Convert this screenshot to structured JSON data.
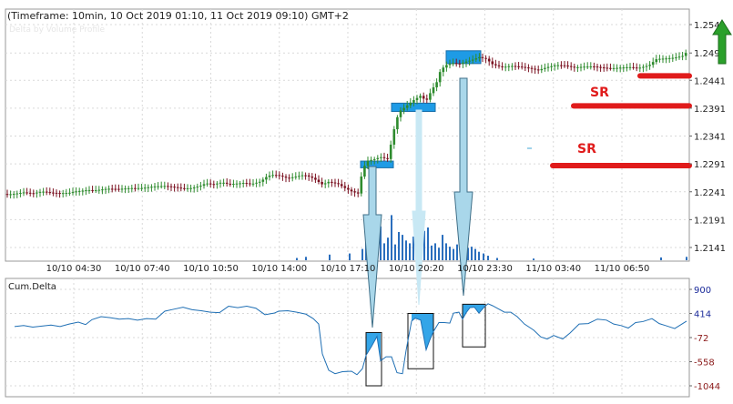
{
  "header": {
    "title": "(Timeframe: 10min, 10 Oct 2019 01:10, 11 Oct 2019 09:10) GMT+2",
    "faint_subtitle": "Delta by Volume Profile"
  },
  "annotations": {
    "sr_upper": "SR",
    "sr_lower": "SR",
    "arrow_icon": "up-arrow-icon"
  },
  "colors": {
    "background": "#ffffff",
    "grid": "#d9d9d9",
    "bull_candle": "#2e8b2e",
    "bear_candle": "#7a1020",
    "volume": "#2a6ebd",
    "cum_delta_line": "#1f6fb4",
    "highlight_box": "#1e9be6",
    "sr_line": "#e01b1b",
    "arrow_fill": "#a9d7ea",
    "green_arrow": "#2ba02b"
  },
  "chart_data": [
    {
      "type": "candlestick",
      "title": "(Timeframe: 10min, 10 Oct 2019 01:10, 11 Oct 2019 09:10) GMT+2",
      "x_tick_labels": [
        "10/10 04:30",
        "10/10 07:40",
        "10/10 10:50",
        "10/10 14:00",
        "10/10 17:10",
        "10/10 20:20",
        "10/10 23:30",
        "11/10 03:40",
        "11/10 06:50"
      ],
      "y_tick_labels": [
        "1.2541",
        "1.2490",
        "1.2441",
        "1.2391",
        "1.2341",
        "1.2291",
        "1.2241",
        "1.2191",
        "1.2141"
      ],
      "ylim": [
        1.2141,
        1.2541
      ],
      "close_path": [
        [
          0,
          1.2237
        ],
        [
          10,
          1.2237
        ],
        [
          20,
          1.2238
        ],
        [
          30,
          1.2235
        ],
        [
          40,
          1.2238
        ],
        [
          50,
          1.2236
        ],
        [
          60,
          1.2236
        ],
        [
          70,
          1.2238
        ],
        [
          78,
          1.2242
        ],
        [
          90,
          1.2246
        ],
        [
          100,
          1.2247
        ],
        [
          112,
          1.225
        ],
        [
          125,
          1.2249
        ],
        [
          137,
          1.2249
        ],
        [
          150,
          1.2247
        ],
        [
          162,
          1.2248
        ],
        [
          175,
          1.2248
        ],
        [
          185,
          1.2246
        ],
        [
          195,
          1.2244
        ],
        [
          205,
          1.2246
        ],
        [
          215,
          1.2252
        ],
        [
          220,
          1.2257
        ],
        [
          228,
          1.2256
        ],
        [
          238,
          1.2261
        ],
        [
          245,
          1.2258
        ],
        [
          252,
          1.2259
        ],
        [
          262,
          1.226
        ],
        [
          270,
          1.2257
        ],
        [
          280,
          1.226
        ],
        [
          288,
          1.2269
        ],
        [
          295,
          1.227
        ],
        [
          302,
          1.2267
        ],
        [
          310,
          1.2262
        ],
        [
          320,
          1.2265
        ],
        [
          328,
          1.2268
        ],
        [
          338,
          1.2263
        ],
        [
          348,
          1.2253
        ],
        [
          355,
          1.2259
        ],
        [
          365,
          1.2257
        ],
        [
          372,
          1.2251
        ],
        [
          380,
          1.2245
        ],
        [
          388,
          1.2241
        ],
        [
          392,
          1.2285
        ],
        [
          398,
          1.23
        ],
        [
          405,
          1.2302
        ],
        [
          412,
          1.2305
        ],
        [
          420,
          1.23
        ],
        [
          426,
          1.2348
        ],
        [
          432,
          1.2383
        ],
        [
          440,
          1.2392
        ],
        [
          448,
          1.2402
        ],
        [
          456,
          1.241
        ],
        [
          462,
          1.24
        ],
        [
          468,
          1.242
        ],
        [
          474,
          1.2436
        ],
        [
          478,
          1.2458
        ],
        [
          485,
          1.2468
        ],
        [
          492,
          1.2472
        ],
        [
          498,
          1.2471
        ],
        [
          505,
          1.2476
        ],
        [
          512,
          1.248
        ],
        [
          520,
          1.2486
        ],
        [
          528,
          1.2483
        ],
        [
          535,
          1.2473
        ],
        [
          545,
          1.2467
        ],
        [
          555,
          1.2468
        ],
        [
          565,
          1.2465
        ],
        [
          575,
          1.2461
        ],
        [
          585,
          1.2456
        ],
        [
          595,
          1.2461
        ],
        [
          605,
          1.2465
        ],
        [
          615,
          1.2465
        ],
        [
          625,
          1.2463
        ],
        [
          635,
          1.2466
        ],
        [
          645,
          1.2468
        ],
        [
          655,
          1.2467
        ],
        [
          665,
          1.2466
        ],
        [
          675,
          1.2467
        ],
        [
          685,
          1.2467
        ],
        [
          695,
          1.2464
        ],
        [
          700,
          1.2465
        ],
        [
          707,
          1.2467
        ],
        [
          715,
          1.2477
        ],
        [
          725,
          1.2477
        ],
        [
          735,
          1.2478
        ],
        [
          745,
          1.2482
        ],
        [
          748,
          1.2489
        ]
      ],
      "horizontal_levels": [
        {
          "label": "SR",
          "value": 1.2395
        },
        {
          "label": "SR",
          "value": 1.2288
        },
        {
          "label": "",
          "value": 1.2449
        }
      ],
      "highlight_zones": [
        {
          "t_start": 390,
          "t_end": 426,
          "low": 1.2284,
          "high": 1.2296
        },
        {
          "t_start": 424,
          "t_end": 472,
          "low": 1.2385,
          "high": 1.24
        },
        {
          "t_start": 484,
          "t_end": 522,
          "low": 1.2471,
          "high": 1.2494
        }
      ]
    },
    {
      "type": "bar",
      "name": "Volume",
      "values": [
        [
          392,
          0.2
        ],
        [
          396,
          0.7
        ],
        [
          400,
          0.35
        ],
        [
          404,
          0.55
        ],
        [
          408,
          0.25
        ],
        [
          412,
          0.6
        ],
        [
          416,
          0.3
        ],
        [
          420,
          0.4
        ],
        [
          424,
          0.8
        ],
        [
          428,
          0.28
        ],
        [
          432,
          0.5
        ],
        [
          436,
          0.45
        ],
        [
          440,
          0.35
        ],
        [
          444,
          0.3
        ],
        [
          448,
          0.42
        ],
        [
          452,
          0.38
        ],
        [
          456,
          0.33
        ],
        [
          460,
          0.52
        ],
        [
          464,
          0.58
        ],
        [
          468,
          0.26
        ],
        [
          472,
          0.3
        ],
        [
          476,
          0.22
        ],
        [
          480,
          0.45
        ],
        [
          484,
          0.3
        ],
        [
          488,
          0.24
        ],
        [
          492,
          0.2
        ],
        [
          496,
          0.28
        ],
        [
          500,
          0.26
        ],
        [
          504,
          0.34
        ],
        [
          508,
          0.22
        ],
        [
          512,
          0.24
        ],
        [
          516,
          0.2
        ],
        [
          520,
          0.15
        ],
        [
          525,
          0.12
        ],
        [
          530,
          0.08
        ],
        [
          320,
          0.04
        ],
        [
          330,
          0.06
        ],
        [
          356,
          0.1
        ],
        [
          378,
          0.12
        ],
        [
          540,
          0.04
        ],
        [
          580,
          0.03
        ],
        [
          720,
          0.05
        ],
        [
          748,
          0.06
        ]
      ]
    },
    {
      "type": "line",
      "name": "Cum.Delta",
      "y_tick_labels": [
        "900",
        "414",
        "-72",
        "-558",
        "-1044"
      ],
      "ylim": [
        -1044,
        900
      ],
      "points": [
        [
          10,
          150
        ],
        [
          20,
          170
        ],
        [
          30,
          140
        ],
        [
          40,
          160
        ],
        [
          50,
          180
        ],
        [
          60,
          150
        ],
        [
          70,
          200
        ],
        [
          80,
          240
        ],
        [
          88,
          190
        ],
        [
          95,
          290
        ],
        [
          105,
          350
        ],
        [
          115,
          330
        ],
        [
          125,
          300
        ],
        [
          135,
          310
        ],
        [
          145,
          280
        ],
        [
          155,
          310
        ],
        [
          165,
          300
        ],
        [
          175,
          460
        ],
        [
          185,
          500
        ],
        [
          195,
          540
        ],
        [
          205,
          490
        ],
        [
          215,
          470
        ],
        [
          225,
          440
        ],
        [
          235,
          430
        ],
        [
          245,
          560
        ],
        [
          255,
          530
        ],
        [
          265,
          560
        ],
        [
          275,
          520
        ],
        [
          285,
          390
        ],
        [
          295,
          420
        ],
        [
          300,
          460
        ],
        [
          310,
          470
        ],
        [
          320,
          440
        ],
        [
          330,
          400
        ],
        [
          338,
          310
        ],
        [
          344,
          200
        ],
        [
          348,
          -400
        ],
        [
          355,
          -730
        ],
        [
          362,
          -800
        ],
        [
          370,
          -760
        ],
        [
          380,
          -750
        ],
        [
          386,
          -820
        ],
        [
          392,
          -700
        ],
        [
          396,
          -430
        ],
        [
          402,
          -250
        ],
        [
          408,
          -50
        ],
        [
          412,
          -540
        ],
        [
          418,
          -460
        ],
        [
          424,
          -460
        ],
        [
          430,
          -780
        ],
        [
          436,
          -800
        ],
        [
          440,
          -330
        ],
        [
          446,
          260
        ],
        [
          450,
          320
        ],
        [
          456,
          280
        ],
        [
          462,
          -320
        ],
        [
          466,
          -120
        ],
        [
          470,
          50
        ],
        [
          476,
          230
        ],
        [
          482,
          230
        ],
        [
          488,
          220
        ],
        [
          492,
          420
        ],
        [
          498,
          440
        ],
        [
          502,
          300
        ],
        [
          506,
          430
        ],
        [
          510,
          530
        ],
        [
          515,
          540
        ],
        [
          520,
          420
        ],
        [
          526,
          550
        ],
        [
          530,
          610
        ],
        [
          535,
          570
        ],
        [
          540,
          520
        ],
        [
          548,
          440
        ],
        [
          555,
          440
        ],
        [
          562,
          350
        ],
        [
          570,
          200
        ],
        [
          580,
          80
        ],
        [
          588,
          -60
        ],
        [
          595,
          -100
        ],
        [
          602,
          -30
        ],
        [
          612,
          -100
        ],
        [
          620,
          20
        ],
        [
          630,
          200
        ],
        [
          640,
          210
        ],
        [
          650,
          300
        ],
        [
          660,
          280
        ],
        [
          668,
          200
        ],
        [
          676,
          170
        ],
        [
          684,
          120
        ],
        [
          692,
          230
        ],
        [
          700,
          250
        ],
        [
          710,
          310
        ],
        [
          718,
          210
        ],
        [
          725,
          170
        ],
        [
          735,
          110
        ],
        [
          742,
          190
        ],
        [
          748,
          260
        ]
      ],
      "outline_boxes": [
        {
          "t_start": 396,
          "t_end": 413,
          "low": -1044,
          "high": 30
        },
        {
          "t_start": 442,
          "t_end": 470,
          "low": -700,
          "high": 414
        },
        {
          "t_start": 502,
          "t_end": 527,
          "low": -260,
          "high": 600
        }
      ]
    }
  ]
}
